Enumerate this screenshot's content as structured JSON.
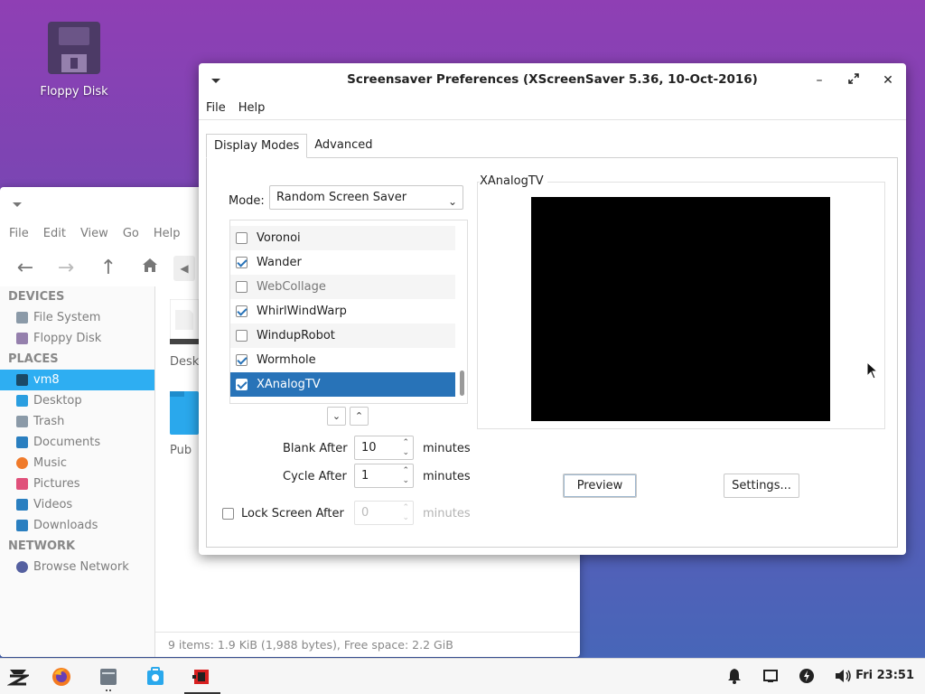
{
  "desktop": {
    "icon_label": "Floppy Disk"
  },
  "file_manager": {
    "menu": [
      "File",
      "Edit",
      "View",
      "Go",
      "Help"
    ],
    "sidebar": {
      "devices_header": "DEVICES",
      "devices": [
        "File System",
        "Floppy Disk"
      ],
      "places_header": "PLACES",
      "places": [
        "vm8",
        "Desktop",
        "Trash",
        "Documents",
        "Music",
        "Pictures",
        "Videos",
        "Downloads"
      ],
      "network_header": "NETWORK",
      "network": [
        "Browse Network"
      ]
    },
    "folders": [
      "Desk",
      "Pub"
    ],
    "status": "9 items: 1.9 KiB (1,988 bytes), Free space: 2.2 GiB"
  },
  "dialog": {
    "title": "Screensaver Preferences  (XScreenSaver 5.36, 10-Oct-2016)",
    "menu": {
      "file": "File",
      "help": "Help"
    },
    "tabs": {
      "display_modes": "Display Modes",
      "advanced": "Advanced"
    },
    "mode_label": "Mode:",
    "mode_value": "Random Screen Saver",
    "hacks": [
      {
        "name": "Voronoi",
        "checked": false
      },
      {
        "name": "Wander",
        "checked": true
      },
      {
        "name": "WebCollage",
        "checked": false
      },
      {
        "name": "WhirlWindWarp",
        "checked": true
      },
      {
        "name": "WindupRobot",
        "checked": false
      },
      {
        "name": "Wormhole",
        "checked": true
      },
      {
        "name": "XAnalogTV",
        "checked": true
      }
    ],
    "blank_after": {
      "label": "Blank After",
      "value": "10",
      "unit": "minutes"
    },
    "cycle_after": {
      "label": "Cycle After",
      "value": "1",
      "unit": "minutes"
    },
    "lock_after": {
      "label": "Lock Screen After",
      "value": "0",
      "unit": "minutes",
      "checked": false
    },
    "preview_title": "XAnalogTV",
    "preview_button": "Preview",
    "settings_button": "Settings..."
  },
  "taskbar": {
    "clock": "Fri 23:51"
  }
}
